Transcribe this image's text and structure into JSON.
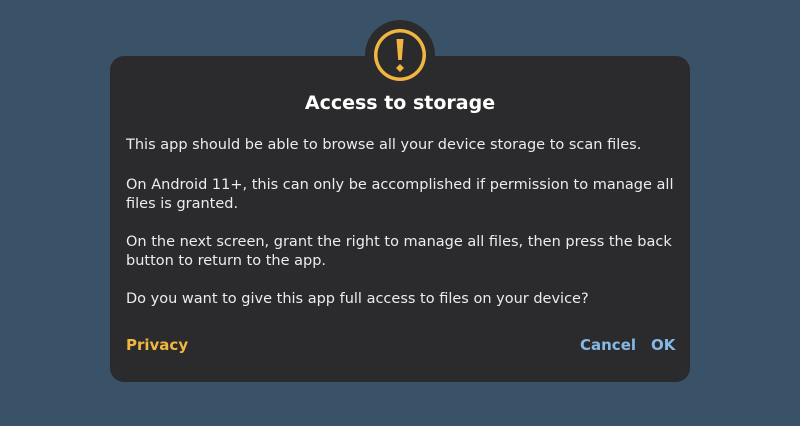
{
  "dialog": {
    "title": "Access to storage",
    "paragraphs": [
      "This app should be able to browse all your device storage to scan files.",
      "On Android 11+, this can only be accomplished if permission to manage all files is granted.",
      "On the next screen, grant the right to manage all files, then press the back button to return to the app.",
      "Do you want to give this app full access to files on your device?"
    ],
    "buttons": {
      "privacy": "Privacy",
      "cancel": "Cancel",
      "ok": "OK"
    }
  },
  "icon": "exclamation-icon",
  "colors": {
    "background": "#3a5268",
    "dialog": "#2b2b2d",
    "accent_orange": "#f0b63f",
    "accent_blue": "#86b8e6"
  }
}
